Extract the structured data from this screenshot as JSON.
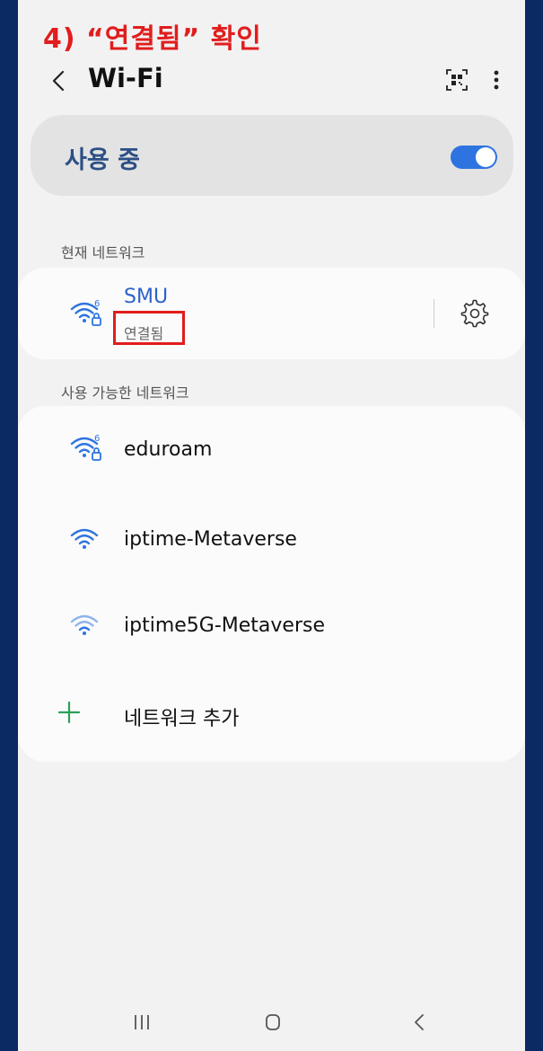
{
  "instruction": {
    "text": "4) “연결됨” 확인"
  },
  "header": {
    "title": "Wi-Fi"
  },
  "master": {
    "label": "사용 중",
    "enabled": true
  },
  "current": {
    "section_label": "현재 네트워크",
    "ssid": "SMU",
    "status": "연결됨"
  },
  "available": {
    "section_label": "사용 가능한 네트워크",
    "networks": [
      {
        "ssid": "eduroam",
        "icon": "wifi6-locked-icon"
      },
      {
        "ssid": "iptime-Metaverse",
        "icon": "wifi-icon"
      },
      {
        "ssid": "iptime5G-Metaverse",
        "icon": "wifi-weak-icon"
      }
    ],
    "add_label": "네트워크 추가"
  },
  "colors": {
    "accent": "#2e74e0",
    "highlight": "#e11d1d",
    "background": "#0b2a63",
    "add_icon": "#2aa05a"
  }
}
